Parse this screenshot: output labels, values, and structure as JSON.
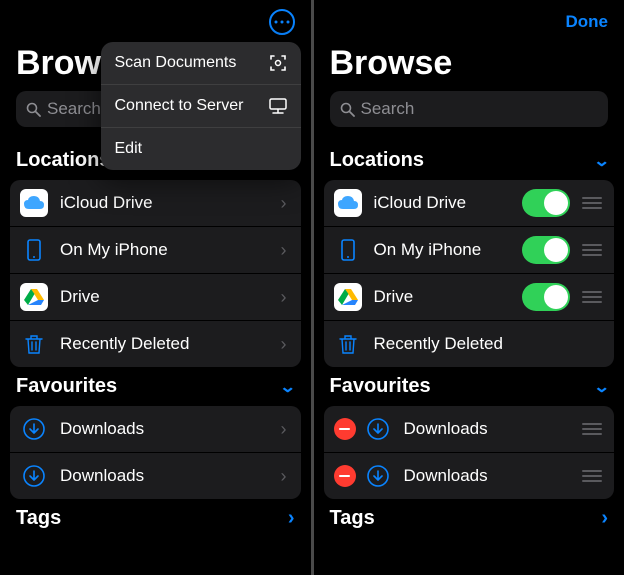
{
  "left": {
    "title": "Browse",
    "search_placeholder": "Search",
    "menu": {
      "scan": "Scan Documents",
      "connect": "Connect to Server",
      "edit": "Edit"
    },
    "sections": {
      "locations": {
        "label": "Locations",
        "items": [
          {
            "label": "iCloud Drive"
          },
          {
            "label": "On My iPhone"
          },
          {
            "label": "Drive"
          },
          {
            "label": "Recently Deleted"
          }
        ]
      },
      "favourites": {
        "label": "Favourites",
        "items": [
          {
            "label": "Downloads"
          },
          {
            "label": "Downloads"
          }
        ]
      },
      "tags": {
        "label": "Tags"
      }
    }
  },
  "right": {
    "title": "Browse",
    "done": "Done",
    "search_placeholder": "Search",
    "sections": {
      "locations": {
        "label": "Locations",
        "items": [
          {
            "label": "iCloud Drive",
            "toggle": true
          },
          {
            "label": "On My iPhone",
            "toggle": true
          },
          {
            "label": "Drive",
            "toggle": true
          },
          {
            "label": "Recently Deleted",
            "toggle": false
          }
        ]
      },
      "favourites": {
        "label": "Favourites",
        "items": [
          {
            "label": "Downloads"
          },
          {
            "label": "Downloads"
          }
        ]
      },
      "tags": {
        "label": "Tags"
      }
    }
  }
}
